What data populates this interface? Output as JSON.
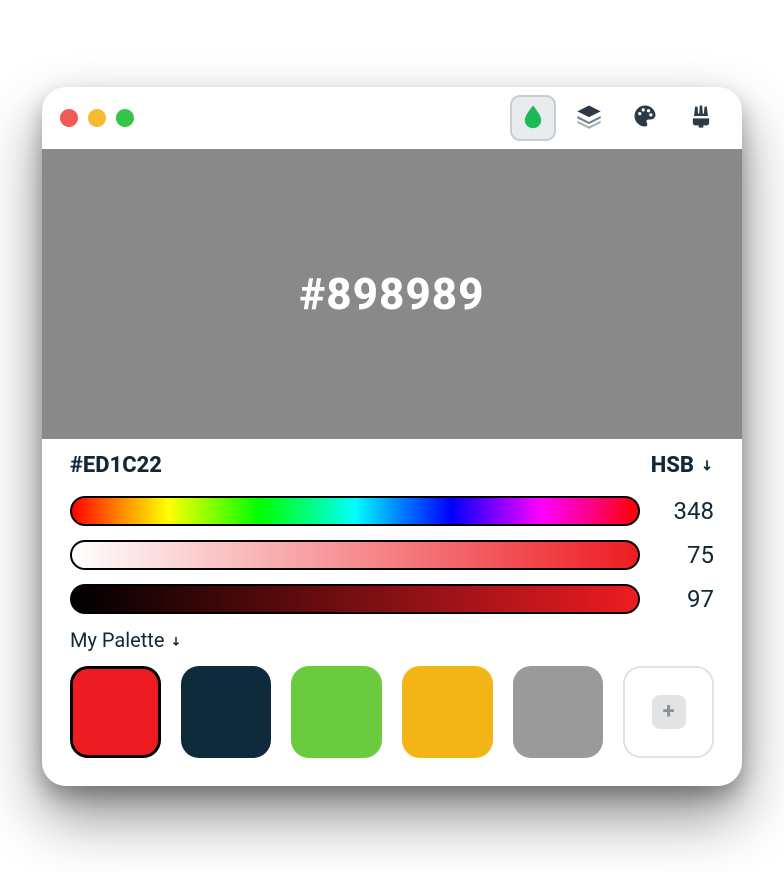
{
  "window": {
    "traffic_lights": [
      "close",
      "minimize",
      "zoom"
    ]
  },
  "toolbar": {
    "tools": [
      {
        "name": "drop-icon",
        "active": true
      },
      {
        "name": "layers-icon",
        "active": false
      },
      {
        "name": "palette-icon",
        "active": false
      },
      {
        "name": "brush-icon",
        "active": false
      }
    ]
  },
  "preview": {
    "color": "#898989",
    "label": "#898989"
  },
  "picker": {
    "hex": "#ED1C22",
    "mode_label": "HSB",
    "channels": {
      "hue": "348",
      "saturation": "75",
      "brightness": "97"
    }
  },
  "palette": {
    "title": "My Palette",
    "swatches": [
      {
        "color": "#ED1C22",
        "selected": true
      },
      {
        "color": "#0F2A3B",
        "selected": false
      },
      {
        "color": "#6BCB3F",
        "selected": false
      },
      {
        "color": "#F3B515",
        "selected": false
      },
      {
        "color": "#9A9A9A",
        "selected": false
      }
    ],
    "add_label": "+"
  }
}
